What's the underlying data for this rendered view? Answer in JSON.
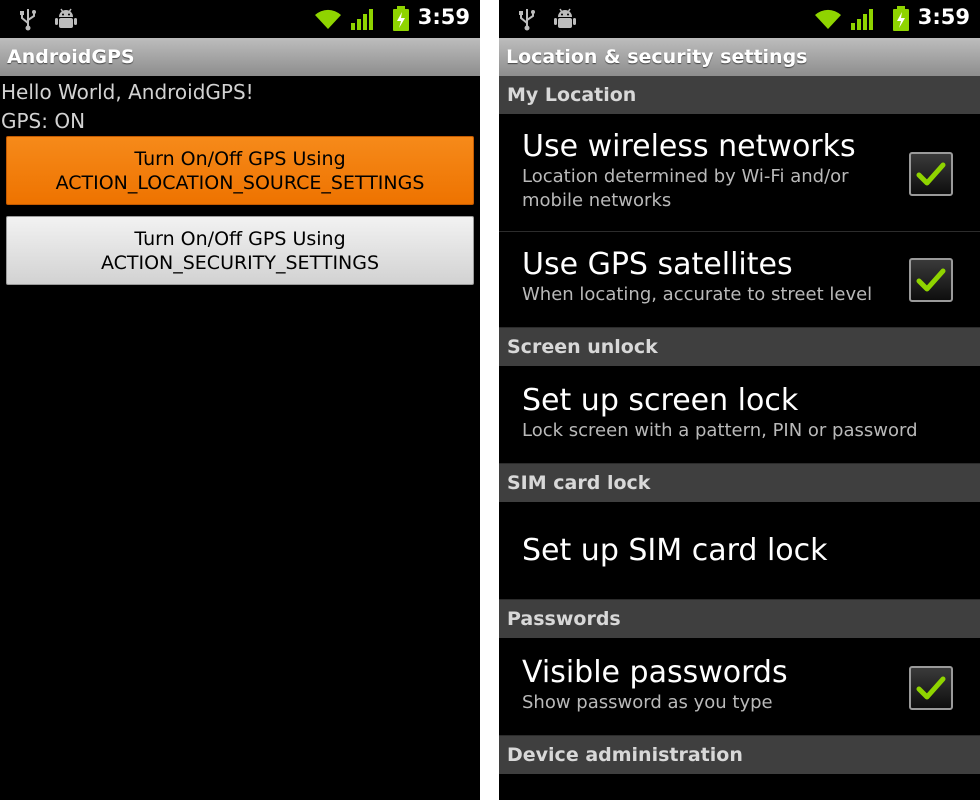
{
  "status_bar": {
    "time": "3:59"
  },
  "left_screen": {
    "title": "AndroidGPS",
    "hello_text": "Hello World, AndroidGPS!",
    "gps_status": "GPS: ON",
    "button_location": {
      "line1": "Turn On/Off GPS Using",
      "line2": "ACTION_LOCATION_SOURCE_SETTINGS"
    },
    "button_security": {
      "line1": "Turn On/Off GPS Using",
      "line2": "ACTION_SECURITY_SETTINGS"
    }
  },
  "right_screen": {
    "title": "Location & security settings",
    "sections": {
      "my_location": "My Location",
      "screen_unlock": "Screen unlock",
      "sim_card_lock": "SIM card lock",
      "passwords": "Passwords",
      "device_administration": "Device administration"
    },
    "prefs": {
      "wireless": {
        "title": "Use wireless networks",
        "summary_line1": "Location determined by Wi-Fi and/or",
        "summary_line2": "mobile networks",
        "checked": true
      },
      "gps": {
        "title": "Use GPS satellites",
        "summary": "When locating, accurate to street level",
        "checked": true
      },
      "screen_lock": {
        "title": "Set up screen lock",
        "summary": "Lock screen with a pattern, PIN or password"
      },
      "sim_lock": {
        "title": "Set up SIM card lock"
      },
      "visible_passwords": {
        "title": "Visible passwords",
        "summary": "Show password as you type",
        "checked": true
      }
    }
  },
  "colors": {
    "accent_orange": "#ee7300",
    "checkmark_green": "#8fd400",
    "title_bar": "#a0a0a0",
    "section_header": "#3f3f3f"
  },
  "icons": [
    "usb-icon",
    "debug-icon",
    "wifi-icon",
    "signal-icon",
    "battery-charging-icon",
    "checkmark-icon"
  ]
}
